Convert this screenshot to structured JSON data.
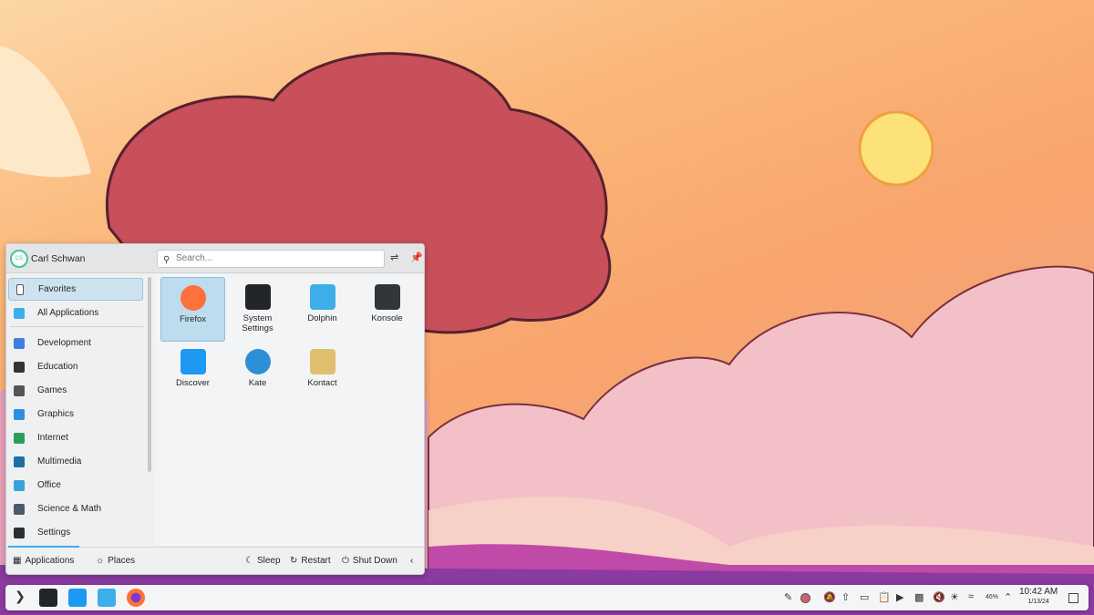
{
  "menu": {
    "user": {
      "initials": "CS",
      "name": "Carl Schwan"
    },
    "search": {
      "placeholder": "Search..."
    },
    "sidebar": [
      {
        "label": "Favorites",
        "color": "#ffffff",
        "selected": true
      },
      {
        "label": "All Applications",
        "color": "#3daee9"
      },
      {
        "label": "Development",
        "color": "#3d7fe0"
      },
      {
        "label": "Education",
        "color": "#333333"
      },
      {
        "label": "Games",
        "color": "#555555"
      },
      {
        "label": "Graphics",
        "color": "#2e8fe0"
      },
      {
        "label": "Internet",
        "color": "#2a9d5b"
      },
      {
        "label": "Multimedia",
        "color": "#1d6fa5"
      },
      {
        "label": "Office",
        "color": "#3aa0d8"
      },
      {
        "label": "Science & Math",
        "color": "#4a5a6a"
      },
      {
        "label": "Settings",
        "color": "#2b2f33"
      }
    ],
    "apps": [
      {
        "label": "Firefox",
        "color": "#ff7139",
        "selected": true
      },
      {
        "label": "System Settings",
        "color": "#232629"
      },
      {
        "label": "Dolphin",
        "color": "#3daee9"
      },
      {
        "label": "Konsole",
        "color": "#31363b"
      },
      {
        "label": "Discover",
        "color": "#1d99f3"
      },
      {
        "label": "Kate",
        "color": "#2d8fd8"
      },
      {
        "label": "Kontact",
        "color": "#e0c070"
      }
    ],
    "footer": {
      "applications": "Applications",
      "places": "Places",
      "sleep": "Sleep",
      "restart": "Restart",
      "shutdown": "Shut Down"
    }
  },
  "taskbar": {
    "time": "10:42 AM",
    "date": "1/13/24",
    "battery": "46%"
  }
}
